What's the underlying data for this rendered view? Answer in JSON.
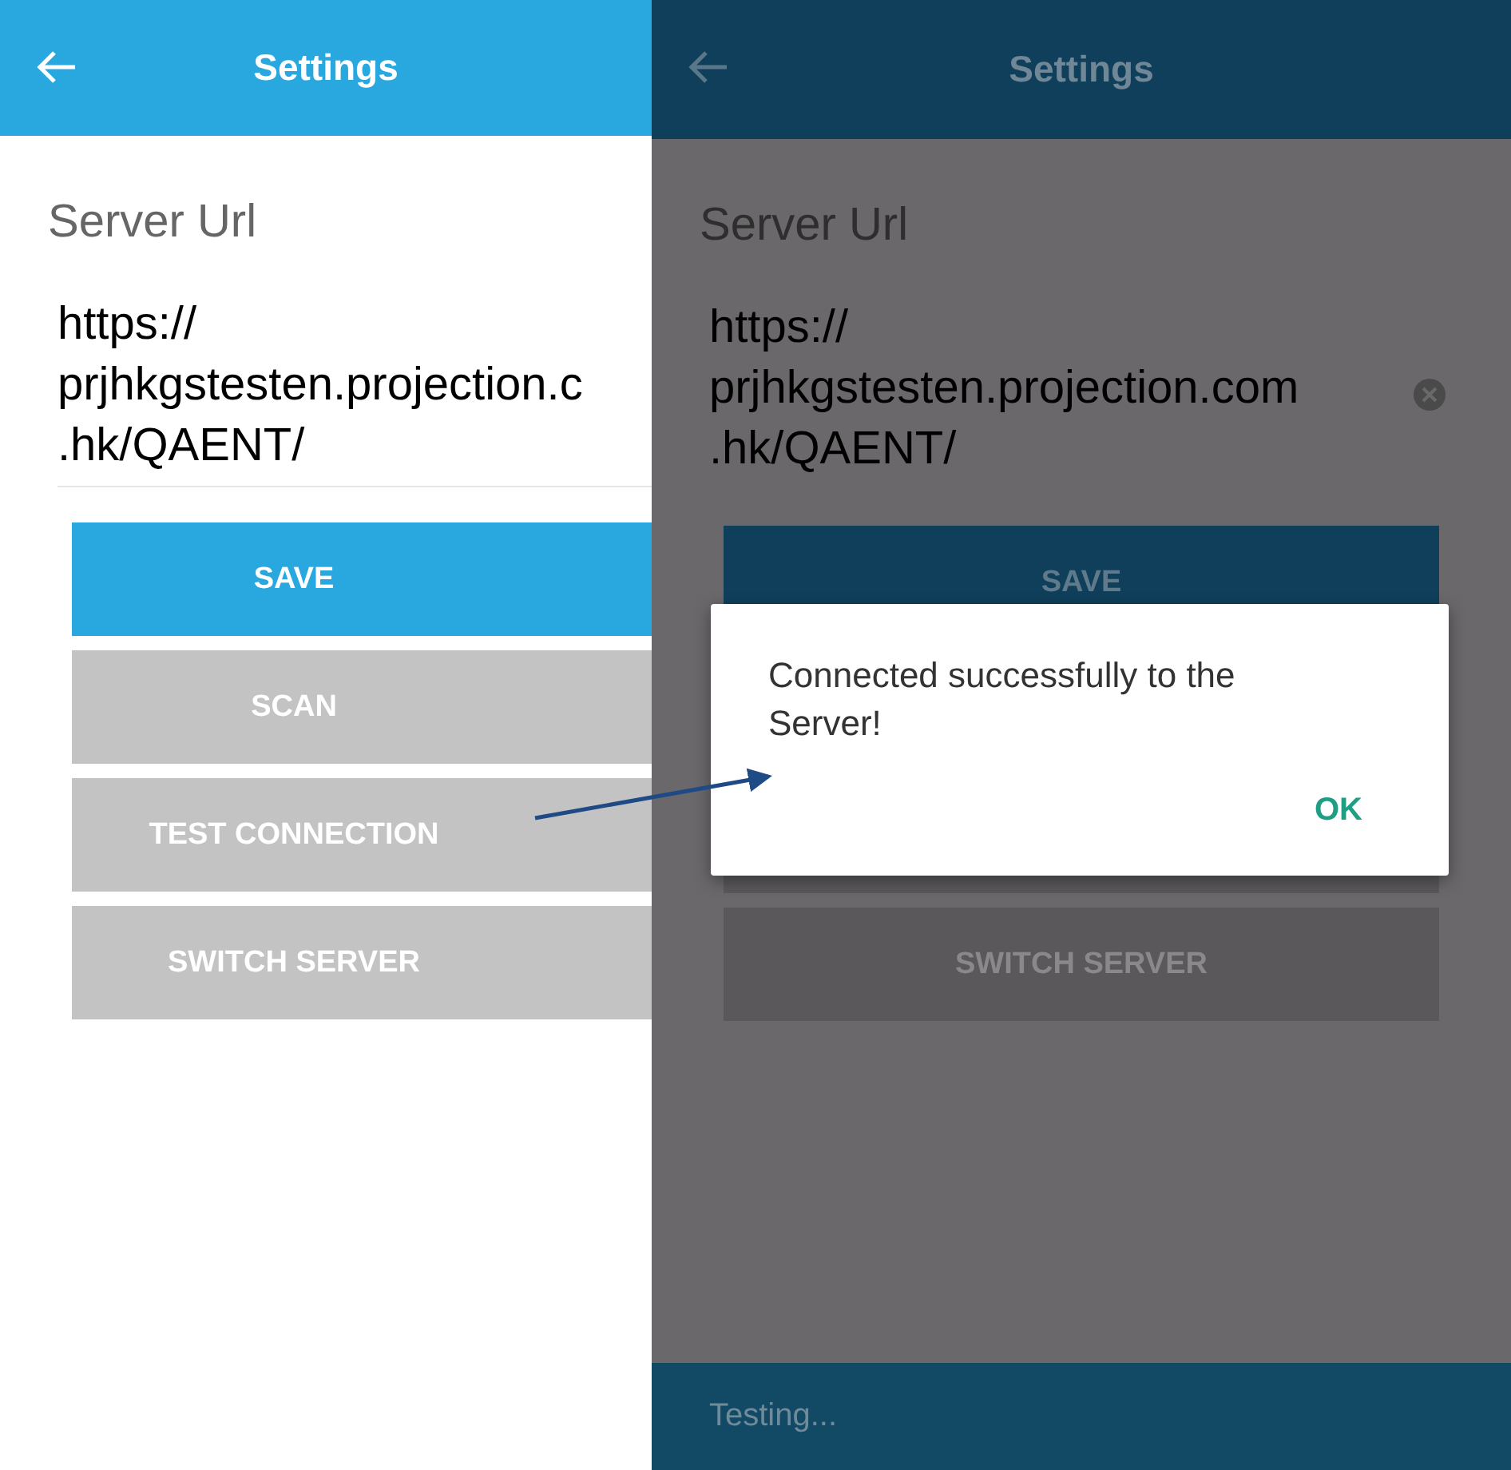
{
  "screens": [
    {
      "title": "Settings",
      "field_label": "Server Url",
      "url_lines": [
        "https://",
        "prjhkgstesten.projection.c",
        ".hk/QAENT/"
      ],
      "dimmed": false,
      "buttons": [
        {
          "kind": "primary",
          "label": "SAVE"
        },
        {
          "kind": "secondary",
          "label": "SCAN"
        },
        {
          "kind": "secondary",
          "label": "TEST CONNECTION"
        },
        {
          "kind": "secondary",
          "label": "SWITCH SERVER"
        }
      ]
    },
    {
      "title": "Settings",
      "field_label": "Server Url",
      "url_lines": [
        "https://",
        "prjhkgstesten.projection.com",
        ".hk/QAENT/"
      ],
      "dimmed": true,
      "clear_button": true,
      "buttons": [
        {
          "kind": "primary",
          "label": "SAVE"
        },
        {
          "kind": "covered"
        },
        {
          "kind": "secondary",
          "label": "SWITCH SERVER"
        }
      ],
      "dialog": {
        "message": "Connected successfully to the Server!",
        "button": "OK"
      },
      "status": "Testing..."
    }
  ]
}
